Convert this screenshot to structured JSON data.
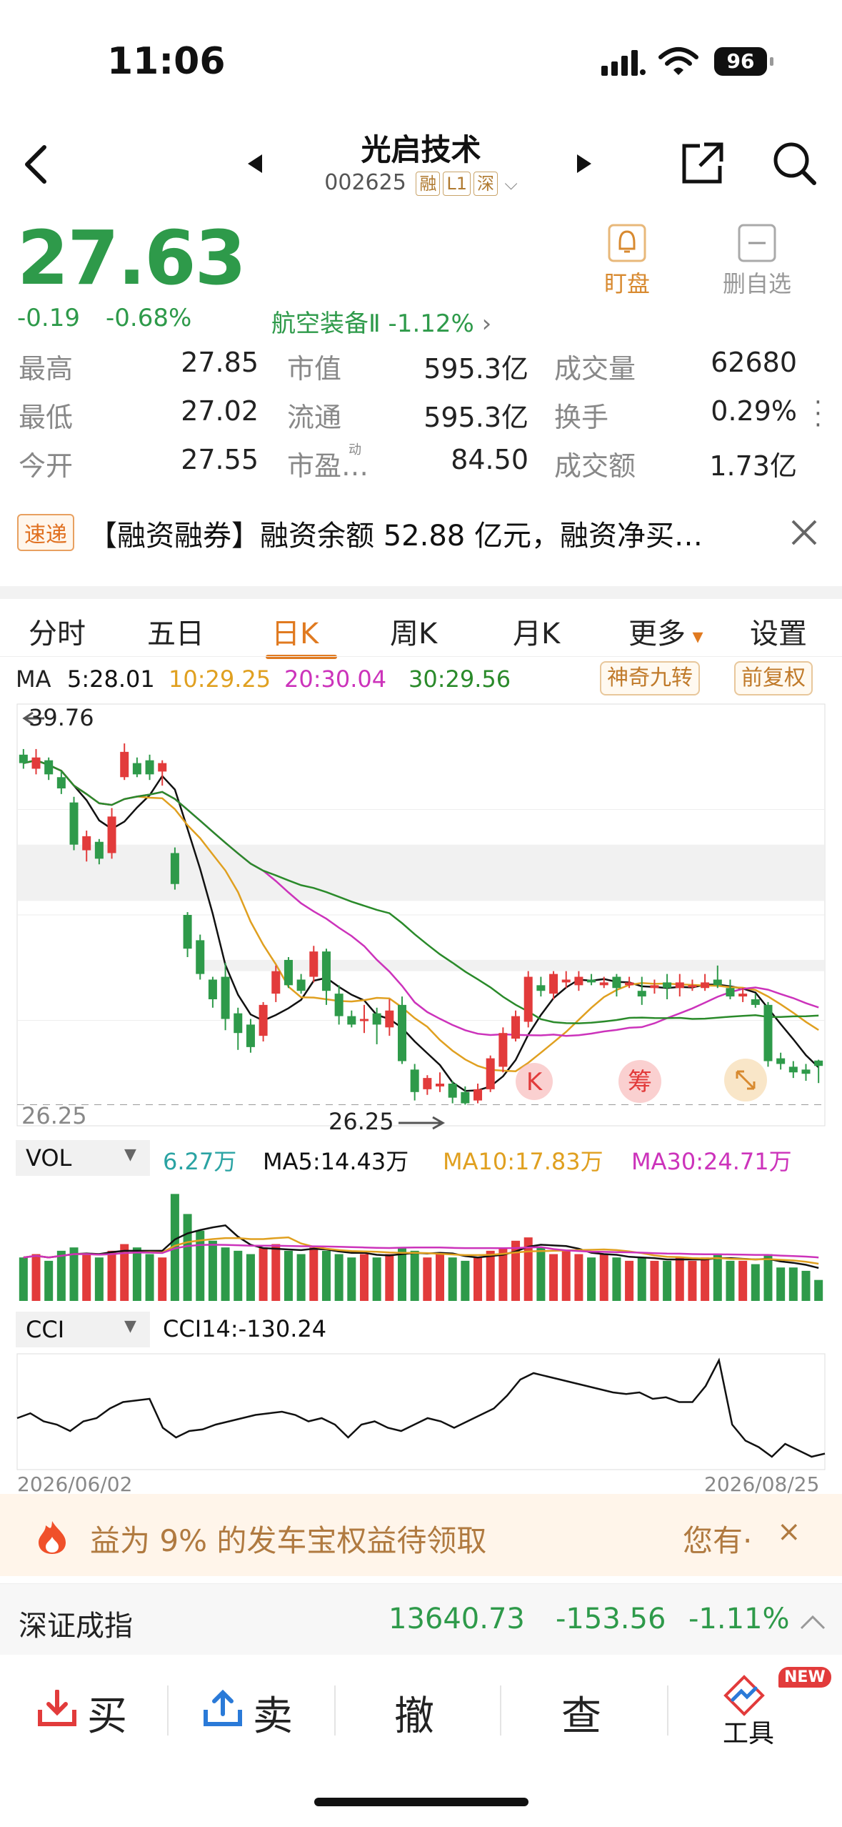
{
  "status": {
    "time": "11:06",
    "battery": "96"
  },
  "header": {
    "title": "光启技术",
    "code": "002625",
    "tags": [
      "融",
      "L1",
      "深"
    ]
  },
  "quote": {
    "price": "27.63",
    "change": "-0.19",
    "change_pct": "-0.68%",
    "sector": "航空装备Ⅱ -1.12%",
    "watch_label": "盯盘",
    "remove_label": "删自选",
    "rows": [
      {
        "l1": "最高",
        "v1": "27.85",
        "l2": "市值",
        "v2": "595.3亿",
        "l3": "成交量",
        "v3": "62680"
      },
      {
        "l1": "最低",
        "v1": "27.02",
        "l2": "流通",
        "v2": "595.3亿",
        "l3": "换手",
        "v3": "0.29%"
      },
      {
        "l1": "今开",
        "v1": "27.55",
        "l2": "市盈…",
        "v2": "84.50",
        "l3": "成交额",
        "v3": "1.73亿"
      }
    ],
    "pe_super": "动"
  },
  "news": {
    "badge": "速递",
    "text": "【融资融券】融资余额 52.88 亿元，融资净买…"
  },
  "tabs": [
    "分时",
    "五日",
    "日K",
    "周K",
    "月K",
    "更多",
    "设置"
  ],
  "ma": {
    "label": "MA",
    "ma5": "5:28.01",
    "ma10": "10:29.25",
    "ma20": "20:30.04",
    "ma30": "30:29.56",
    "btn1": "神奇九转",
    "btn2": "前复权"
  },
  "colors": {
    "up": "#e23b3b",
    "down": "#2e9a4a",
    "ma5": "#111111",
    "ma10": "#e0a020",
    "ma20": "#cc33bb",
    "ma30": "#2a8a2a"
  },
  "kline": {
    "high_label": "39.76",
    "low_label": "26.25",
    "axis_low": "26.25",
    "markers": [
      "K",
      "筹"
    ],
    "ylim": [
      25.5,
      40.5
    ]
  },
  "vol": {
    "label": "VOL",
    "value": "6.27万",
    "ma5": "MA5:14.43万",
    "ma10": "MA10:17.83万",
    "ma30": "MA30:24.71万"
  },
  "cci": {
    "label": "CCI",
    "value": "CCI14:-130.24"
  },
  "dates": {
    "start": "2026/06/02",
    "end": "2026/08/25"
  },
  "promo": {
    "text": "益为 9% 的发车宝权益待领取",
    "right": "您有·"
  },
  "index": {
    "name": "深证成指",
    "value": "13640.73",
    "change": "-153.56",
    "pct": "-1.11%"
  },
  "bottom": {
    "buy": "买",
    "sell": "卖",
    "cancel": "撤",
    "query": "查",
    "tools": "工具",
    "new_badge": "NEW"
  },
  "chart_data": {
    "type": "candlestick",
    "candles": [
      [
        38.7,
        38.4,
        38.9,
        38.2
      ],
      [
        38.2,
        38.6,
        38.9,
        38.0
      ],
      [
        38.5,
        38.0,
        38.6,
        37.8
      ],
      [
        37.9,
        37.5,
        38.1,
        37.3
      ],
      [
        37.0,
        35.5,
        37.2,
        35.3
      ],
      [
        35.3,
        35.8,
        36.0,
        34.9
      ],
      [
        35.6,
        35.0,
        35.7,
        34.8
      ],
      [
        35.2,
        36.5,
        36.8,
        35.0
      ],
      [
        37.9,
        38.8,
        39.1,
        37.8
      ],
      [
        38.4,
        38.0,
        38.6,
        37.9
      ],
      [
        38.5,
        38.0,
        38.7,
        37.8
      ],
      [
        38.1,
        38.4,
        38.5,
        37.6
      ],
      [
        35.2,
        34.1,
        35.4,
        33.9
      ],
      [
        33.0,
        31.8,
        33.1,
        31.5
      ],
      [
        32.1,
        30.9,
        32.3,
        30.7
      ],
      [
        30.7,
        30.0,
        30.8,
        29.7
      ],
      [
        30.8,
        29.3,
        31.3,
        28.9
      ],
      [
        29.5,
        28.8,
        29.7,
        28.2
      ],
      [
        29.1,
        28.3,
        29.3,
        28.1
      ],
      [
        28.7,
        29.8,
        29.9,
        28.5
      ],
      [
        30.2,
        31.0,
        31.2,
        29.9
      ],
      [
        31.4,
        30.5,
        31.5,
        30.4
      ],
      [
        30.7,
        30.3,
        30.9,
        30.2
      ],
      [
        30.8,
        31.7,
        31.9,
        30.6
      ],
      [
        31.7,
        30.3,
        31.8,
        29.8
      ],
      [
        30.2,
        29.4,
        30.5,
        29.1
      ],
      [
        29.4,
        29.1,
        29.6,
        29.0
      ],
      [
        29.3,
        29.3,
        29.8,
        28.8
      ],
      [
        29.5,
        29.1,
        29.7,
        28.4
      ],
      [
        29.0,
        29.6,
        30.0,
        28.7
      ],
      [
        29.8,
        27.8,
        30.1,
        27.7
      ],
      [
        27.5,
        26.7,
        27.7,
        26.4
      ],
      [
        26.8,
        27.2,
        27.3,
        26.6
      ],
      [
        26.9,
        27.0,
        27.4,
        26.7
      ],
      [
        27.0,
        26.5,
        27.1,
        26.3
      ],
      [
        26.7,
        26.3,
        26.9,
        26.25
      ],
      [
        26.4,
        26.8,
        27.0,
        26.3
      ],
      [
        26.8,
        27.9,
        28.0,
        26.7
      ],
      [
        27.6,
        28.8,
        29.0,
        27.4
      ],
      [
        28.6,
        29.4,
        29.6,
        28.5
      ],
      [
        29.2,
        30.8,
        31.0,
        29.0
      ],
      [
        30.5,
        30.3,
        30.8,
        30.1
      ],
      [
        30.2,
        30.9,
        31.0,
        30.0
      ],
      [
        30.6,
        30.7,
        31.0,
        30.4
      ],
      [
        30.5,
        30.8,
        31.0,
        30.3
      ],
      [
        30.7,
        30.6,
        30.9,
        30.5
      ],
      [
        30.5,
        30.6,
        30.8,
        30.4
      ],
      [
        30.8,
        30.4,
        30.9,
        30.1
      ],
      [
        30.5,
        30.6,
        30.8,
        30.4
      ],
      [
        30.3,
        30.1,
        30.8,
        29.8
      ],
      [
        30.4,
        30.5,
        30.7,
        30.2
      ],
      [
        30.6,
        30.4,
        30.9,
        30.0
      ],
      [
        30.4,
        30.6,
        30.9,
        30.1
      ],
      [
        30.5,
        30.5,
        30.7,
        30.3
      ],
      [
        30.4,
        30.6,
        30.9,
        30.3
      ],
      [
        30.7,
        30.5,
        31.2,
        30.4
      ],
      [
        30.4,
        30.1,
        30.7,
        30.0
      ],
      [
        30.1,
        30.2,
        30.4,
        29.9
      ],
      [
        30.0,
        29.8,
        30.2,
        29.7
      ],
      [
        29.8,
        27.8,
        29.9,
        27.6
      ],
      [
        27.9,
        27.7,
        28.1,
        27.5
      ],
      [
        27.6,
        27.4,
        27.8,
        27.2
      ],
      [
        27.5,
        27.35,
        27.7,
        27.1
      ],
      [
        27.82,
        27.63,
        27.85,
        27.02
      ]
    ],
    "volume": [
      13,
      14,
      12,
      15,
      16,
      14,
      13,
      15,
      17,
      16,
      14,
      13,
      32,
      26,
      21,
      18,
      16,
      15,
      14,
      16,
      17,
      15,
      14,
      16,
      15,
      14,
      13,
      14,
      13,
      14,
      16,
      15,
      13,
      14,
      13,
      12,
      13,
      15,
      16,
      18,
      19,
      16,
      14,
      15,
      14,
      13,
      14,
      13,
      12,
      13,
      12,
      12,
      13,
      12,
      13,
      14,
      12,
      12,
      11,
      14,
      10,
      10,
      9,
      6.27
    ],
    "cci": [
      -20,
      -5,
      -30,
      -40,
      -60,
      -30,
      -20,
      10,
      30,
      35,
      40,
      -50,
      -80,
      -60,
      -55,
      -40,
      -30,
      -20,
      -10,
      -5,
      0,
      -10,
      -30,
      -20,
      -40,
      -80,
      -40,
      -30,
      -50,
      -60,
      -40,
      -20,
      -30,
      -50,
      -30,
      -10,
      10,
      50,
      100,
      120,
      110,
      100,
      90,
      80,
      70,
      60,
      55,
      60,
      40,
      45,
      30,
      30,
      80,
      160,
      -40,
      -90,
      -110,
      -140,
      -100,
      -120,
      -140,
      -130.24
    ]
  }
}
